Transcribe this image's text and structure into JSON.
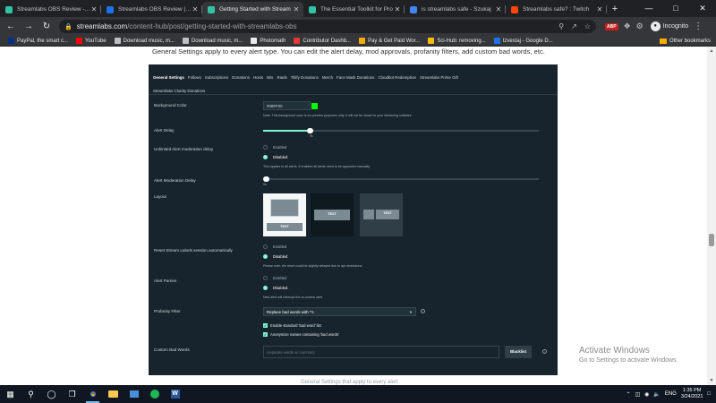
{
  "browser": {
    "tabs": [
      {
        "title": "Streamlabs OBS Review - St",
        "color": "#31c3a2"
      },
      {
        "title": "Streamlabs OBS Review | Th",
        "color": "#1a73e8"
      },
      {
        "title": "Getting Started with Stream",
        "color": "#31c3a2",
        "active": true
      },
      {
        "title": "The Essential Toolkit for Pro",
        "color": "#31c3a2"
      },
      {
        "title": "is streamlabs safe - Szukaj",
        "color": "#4285f4"
      },
      {
        "title": "Streamlabs safe? : Twitch",
        "color": "#ff4500"
      }
    ],
    "new_tab": "+",
    "url_host": "streamlabs.com",
    "url_path": "/content-hub/post/getting-started-with-streamlabs-obs",
    "incognito_label": "Incognito",
    "abp_label": "ABP",
    "bookmarks": [
      {
        "label": "PayPal, the smart c...",
        "color": "#003087"
      },
      {
        "label": "YouTube",
        "color": "#ff0000"
      },
      {
        "label": "Download music, m...",
        "color": "#bdc1c6"
      },
      {
        "label": "Download music, m...",
        "color": "#bdc1c6"
      },
      {
        "label": "Photomath",
        "color": "#e8eaed"
      },
      {
        "label": "Contributor Dashb...",
        "color": "#e53935"
      },
      {
        "label": "Pay & Get Paid Wor...",
        "color": "#f9ab00"
      },
      {
        "label": "Sci-Hub: removing...",
        "color": "#fbbc04"
      },
      {
        "label": "Izvestaj - Google D...",
        "color": "#1a73e8"
      }
    ],
    "other_bookmarks": "Other bookmarks"
  },
  "page": {
    "intro": "General Settings apply to every alert type. You can edit the alert delay, mod approvals, profanity filters, add custom bad words, etc.",
    "tabs": [
      "General Settings",
      "Follows",
      "Subscriptions",
      "Donations",
      "Hosts",
      "Bits",
      "Raids",
      "Tiltify Donations",
      "Merch",
      "Face Mask Donations",
      "Cloudbot Redemption",
      "Streamlabs Prime Gift",
      "Streamlabs Charity Donations"
    ],
    "background_color": {
      "label": "Background Color",
      "value": "#00FF00",
      "note": "Note: This background color is for preview purposes only. It will not be shown in your streaming software."
    },
    "alert_delay": {
      "label": "Alert Delay",
      "value": 0.17,
      "tick": "9s"
    },
    "unlimited_moderation": {
      "label": "Unlimited Alert moderation delay",
      "options": [
        "Enabled",
        "Disabled"
      ],
      "selected": "Disabled",
      "note": "This applies to all alerts. If enabled all alerts need to be approved manually."
    },
    "moderation_delay": {
      "label": "Alert Moderation Delay",
      "value": 0.0,
      "tick": "0s"
    },
    "layout": {
      "label": "Layout",
      "card_text": "TEXT",
      "selected": 0
    },
    "reset_session": {
      "label": "Reset Stream Labels session automatically",
      "options": [
        "Enabled",
        "Disabled"
      ],
      "selected": "Disabled",
      "note": "Please note, the reset could be slightly delayed due to api restrictions."
    },
    "alert_parries": {
      "label": "Alert Parries",
      "options": [
        "Enabled",
        "Disabled"
      ],
      "selected": "Disabled",
      "note": "New alert will interrupt the on screen alert"
    },
    "profanity": {
      "label": "Profanity Filter",
      "value": "Replace bad words with *'s",
      "checks": [
        "Enable standard 'bad word' list",
        "Anonymize names containing 'bad words'"
      ]
    },
    "custom_words": {
      "label": "Custom Bad Words",
      "placeholder": "(separate words w/ commas)",
      "button": "Blacklist"
    },
    "below_text": "General Settings that apply to every alert"
  },
  "watermark": {
    "line1": "Activate Windows",
    "line2": "Go to Settings to activate Windows."
  },
  "taskbar": {
    "lang": "ENG",
    "time": "1:35 PM",
    "date": "3/24/2021"
  }
}
